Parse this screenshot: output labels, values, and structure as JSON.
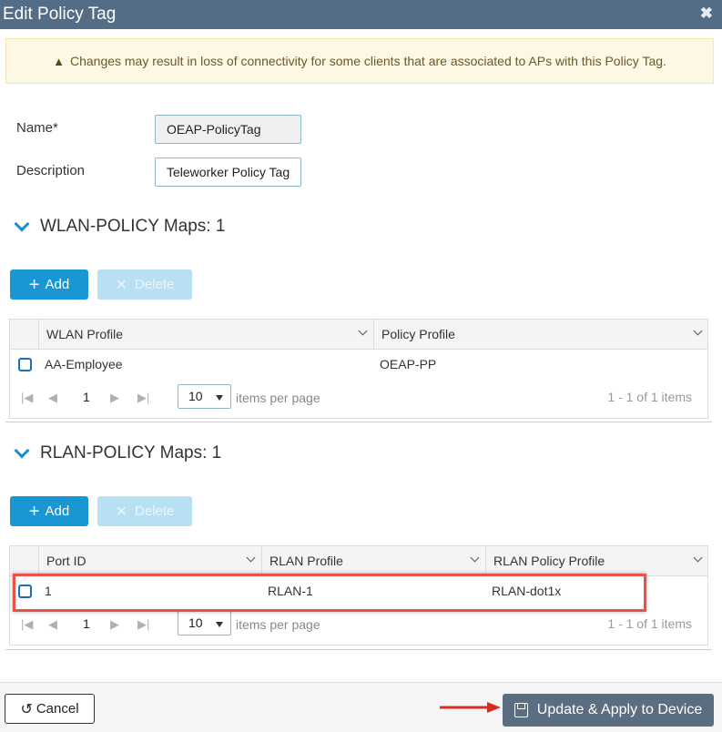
{
  "dialog": {
    "title": "Edit Policy Tag",
    "close_icon": "close-icon",
    "warning": "Changes may result in loss of connectivity for some clients that are associated to APs with this Policy Tag."
  },
  "form": {
    "name_label": "Name*",
    "name_value": "OEAP-PolicyTag",
    "description_label": "Description",
    "description_value": "Teleworker Policy Tag"
  },
  "wlan": {
    "title": "WLAN-POLICY Maps: 1",
    "add_label": "Add",
    "delete_label": "Delete",
    "columns": [
      "WLAN Profile",
      "Policy Profile"
    ],
    "rows": [
      {
        "wlan_profile": "AA-Employee",
        "policy_profile": "OEAP-PP"
      }
    ],
    "page": "1",
    "page_size": "10",
    "items_per_page": "items per page",
    "count": "1 - 1 of 1 items"
  },
  "rlan": {
    "title": "RLAN-POLICY Maps: 1",
    "add_label": "Add",
    "delete_label": "Delete",
    "columns": [
      "Port ID",
      "RLAN Profile",
      "RLAN Policy Profile"
    ],
    "rows": [
      {
        "port_id": "1",
        "rlan_profile": "RLAN-1",
        "rlan_policy_profile": "RLAN-dot1x"
      }
    ],
    "page": "1",
    "page_size": "10",
    "items_per_page": "items per page",
    "count": "1 - 1 of 1 items"
  },
  "footer": {
    "cancel_label": "Cancel",
    "apply_label": "Update & Apply to Device"
  },
  "colors": {
    "titlebar": "#536d87",
    "primary": "#1a96d3",
    "highlight": "#e8524a",
    "apply_button": "#5b6d80"
  }
}
